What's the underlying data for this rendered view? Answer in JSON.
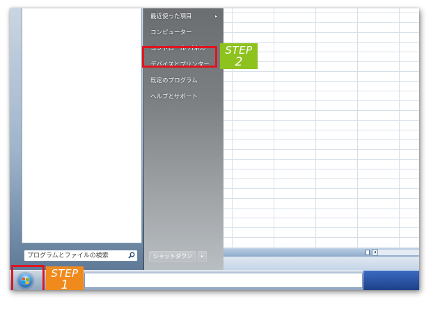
{
  "start_menu": {
    "right_items": [
      {
        "label": "最近使った項目",
        "has_submenu": true
      },
      {
        "label": "コンピューター",
        "has_submenu": false
      },
      {
        "label": "コントロール パネル",
        "has_submenu": false
      },
      {
        "label": "デバイスとプリンター",
        "has_submenu": false
      },
      {
        "label": "既定のプログラム",
        "has_submenu": false
      },
      {
        "label": "ヘルプとサポート",
        "has_submenu": false
      }
    ],
    "submenu_arrow": "▸",
    "search": {
      "placeholder": "プログラムとファイルの検索",
      "icon": "search-icon"
    },
    "shutdown": {
      "label": "シャットダウン",
      "arrow": "▸"
    }
  },
  "scrollbar": {
    "arrow": "◂"
  },
  "taskbar": {
    "start_icon": "windows-orb-icon"
  },
  "annotations": {
    "step1": {
      "line1": "STEP",
      "line2": "1",
      "color": "#f08a1c"
    },
    "step2": {
      "line1": "STEP",
      "line2": "2",
      "color": "#8dc21f"
    },
    "highlight_color": "#e0141e"
  }
}
